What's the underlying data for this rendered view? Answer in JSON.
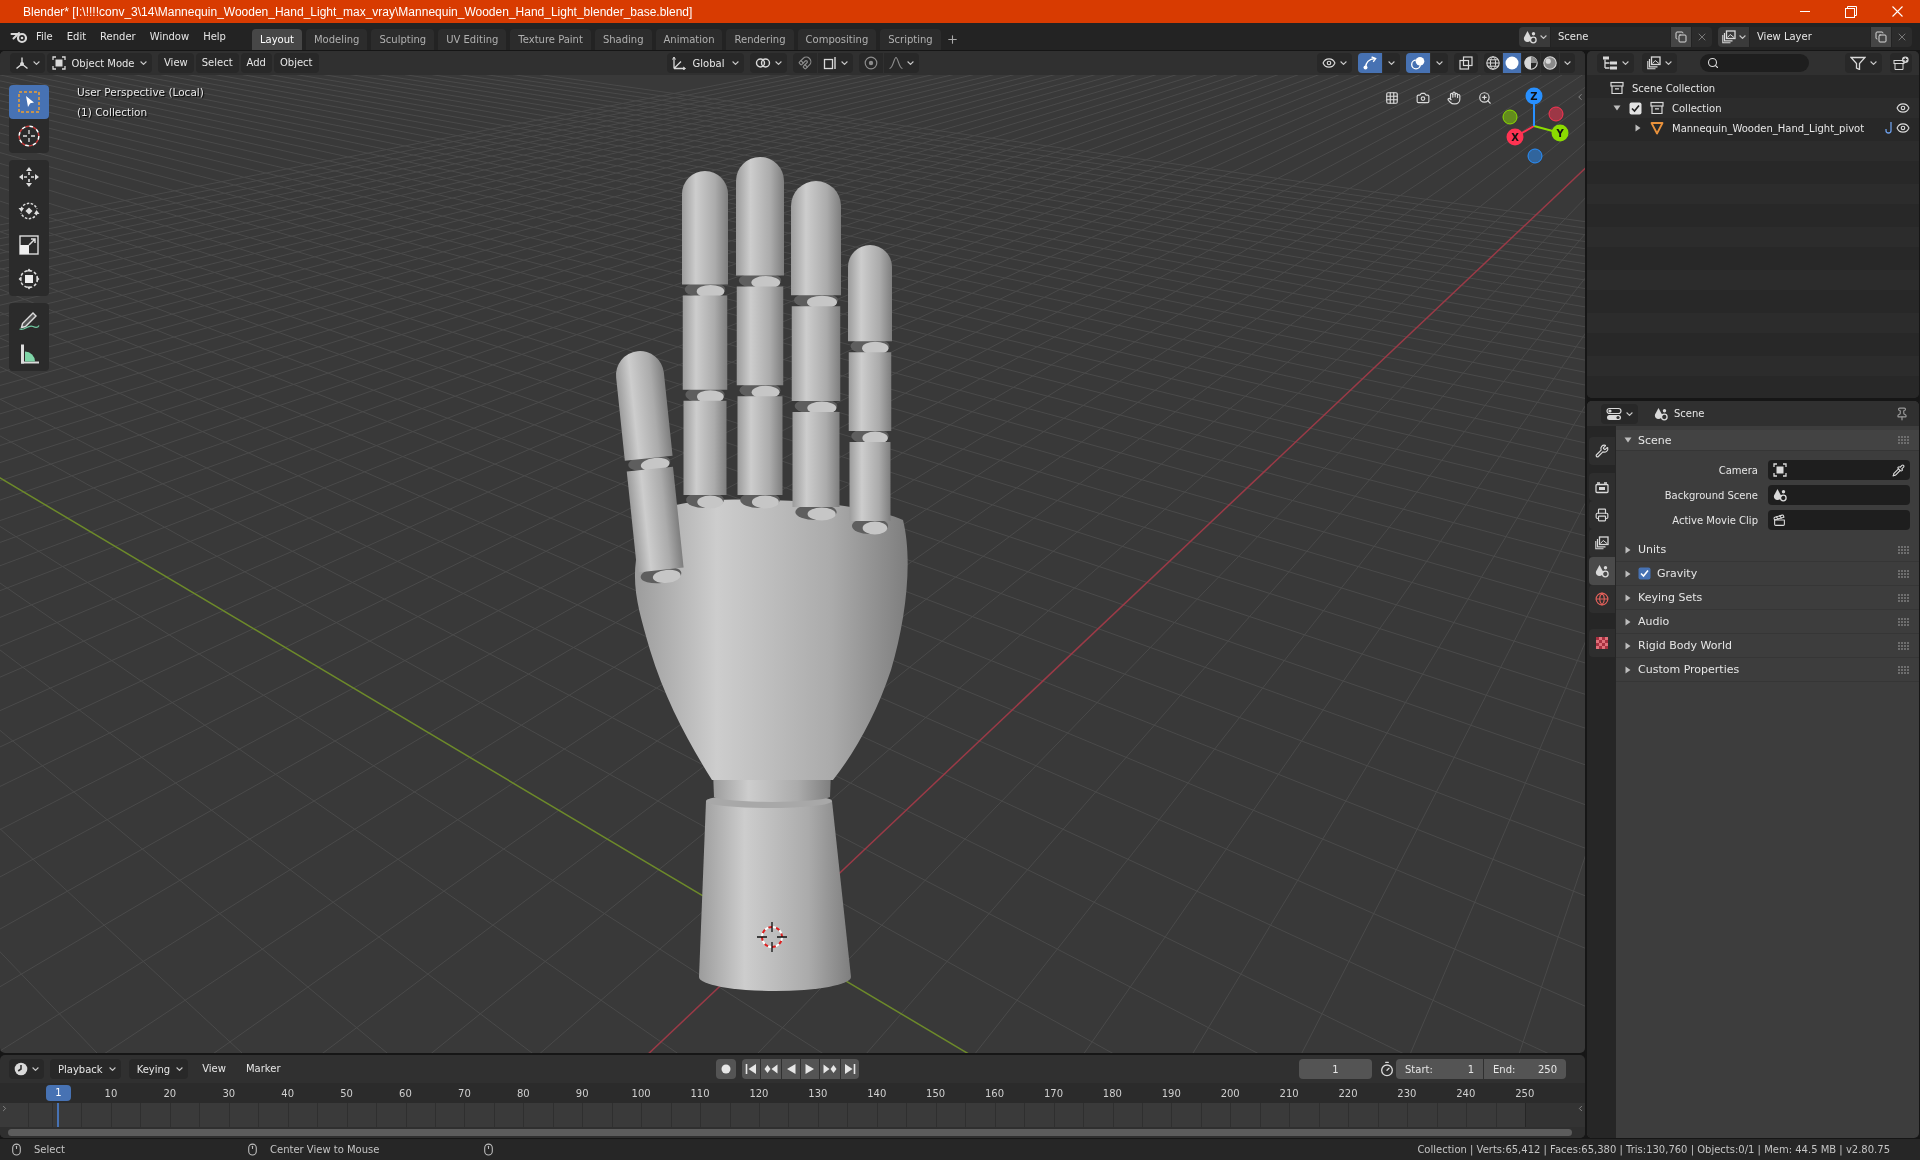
{
  "window": {
    "title": "Blender* [I:\\!!!!conv_3\\14\\Mannequin_Wooden_Hand_Light_max_vray\\Mannequin_Wooden_Hand_Light_blender_base.blend]"
  },
  "menu": [
    "File",
    "Edit",
    "Render",
    "Window",
    "Help"
  ],
  "workspaces": [
    {
      "label": "Layout",
      "selected": true
    },
    {
      "label": "Modeling",
      "selected": false
    },
    {
      "label": "Sculpting",
      "selected": false
    },
    {
      "label": "UV Editing",
      "selected": false
    },
    {
      "label": "Texture Paint",
      "selected": false
    },
    {
      "label": "Shading",
      "selected": false
    },
    {
      "label": "Animation",
      "selected": false
    },
    {
      "label": "Rendering",
      "selected": false
    },
    {
      "label": "Compositing",
      "selected": false
    },
    {
      "label": "Scripting",
      "selected": false
    }
  ],
  "scene": {
    "name": "Scene",
    "view_layer": "View Layer"
  },
  "viewport": {
    "mode": "Object Mode",
    "menus": [
      "View",
      "Select",
      "Add",
      "Object"
    ],
    "orientation": "Global",
    "toggles": {
      "gizmos": true,
      "overlays": true,
      "xray": false
    },
    "shading": [
      {
        "kind": "wireframe",
        "selected": false
      },
      {
        "kind": "solid",
        "selected": true
      },
      {
        "kind": "material",
        "selected": false
      },
      {
        "kind": "rendered",
        "selected": false
      }
    ],
    "tools": [
      {
        "kind": "select_box",
        "selected": true
      },
      {
        "kind": "cursor",
        "selected": false
      },
      {
        "kind": "move",
        "selected": false
      },
      {
        "kind": "rotate",
        "selected": false
      },
      {
        "kind": "scale",
        "selected": false
      },
      {
        "kind": "transform",
        "selected": false
      },
      {
        "kind": "annotate",
        "selected": false
      },
      {
        "kind": "measure",
        "selected": false
      }
    ],
    "view_name": "User Perspective (Local)",
    "collection": "(1) Collection",
    "gizmo_axes": [
      {
        "label": "X",
        "color": "#ff3352"
      },
      {
        "label": "Y",
        "color": "#8bdc00"
      },
      {
        "label": "Z",
        "color": "#2890ff"
      }
    ]
  },
  "outliner": {
    "tree": [
      {
        "label": "Scene Collection",
        "kind": "scene_collection",
        "children": [
          {
            "label": "Collection",
            "kind": "collection",
            "checked": true,
            "expanded": true,
            "children": [
              {
                "label": "Mannequin_Wooden_Hand_Light_pivot",
                "kind": "mesh",
                "expanded": false
              }
            ]
          }
        ]
      }
    ]
  },
  "properties": {
    "context": "Scene",
    "tabs": [
      {
        "kind": "tool",
        "selected": false
      },
      {
        "kind": "render",
        "selected": false
      },
      {
        "kind": "output",
        "selected": false
      },
      {
        "kind": "view_layer",
        "selected": false
      },
      {
        "kind": "scene",
        "selected": true
      },
      {
        "kind": "world",
        "selected": false
      },
      {
        "kind": "texture",
        "selected": false
      }
    ],
    "panel": {
      "title": "Scene",
      "expanded": true,
      "fields": [
        {
          "label": "Camera",
          "kind": "camera"
        },
        {
          "label": "Background Scene",
          "kind": "scene"
        },
        {
          "label": "Active Movie Clip",
          "kind": "clip"
        }
      ]
    },
    "subpanels": [
      {
        "label": "Units",
        "kind": "plain",
        "expanded": false
      },
      {
        "label": "Gravity",
        "kind": "checkbox",
        "checked": true,
        "expanded": false
      },
      {
        "label": "Keying Sets",
        "kind": "plain",
        "expanded": false
      },
      {
        "label": "Audio",
        "kind": "plain",
        "expanded": false
      },
      {
        "label": "Rigid Body World",
        "kind": "plain",
        "expanded": false
      },
      {
        "label": "Custom Properties",
        "kind": "plain",
        "expanded": false
      }
    ]
  },
  "timeline": {
    "menus": [
      {
        "label": "Playback",
        "kind": "dropdown"
      },
      {
        "label": "Keying",
        "kind": "dropdown"
      },
      {
        "label": "View",
        "kind": "menu"
      },
      {
        "label": "Marker",
        "kind": "menu"
      }
    ],
    "current_frame": "1",
    "start": {
      "label": "Start:",
      "value": "1"
    },
    "end": {
      "label": "End:",
      "value": "250"
    },
    "ruler": {
      "playhead": "1",
      "ticks": [
        "10",
        "20",
        "30",
        "40",
        "50",
        "60",
        "70",
        "80",
        "90",
        "100",
        "110",
        "120",
        "130",
        "140",
        "150",
        "160",
        "170",
        "180",
        "190",
        "200",
        "210",
        "220",
        "230",
        "240",
        "250"
      ]
    }
  },
  "status_bar": {
    "hints": [
      "Select",
      "Center View to Mouse"
    ],
    "stats": "Collection | Verts:65,412 | Faces:65,380 | Tris:130,760 | Objects:0/1 | Mem: 44.5 MB | v2.80.75"
  }
}
